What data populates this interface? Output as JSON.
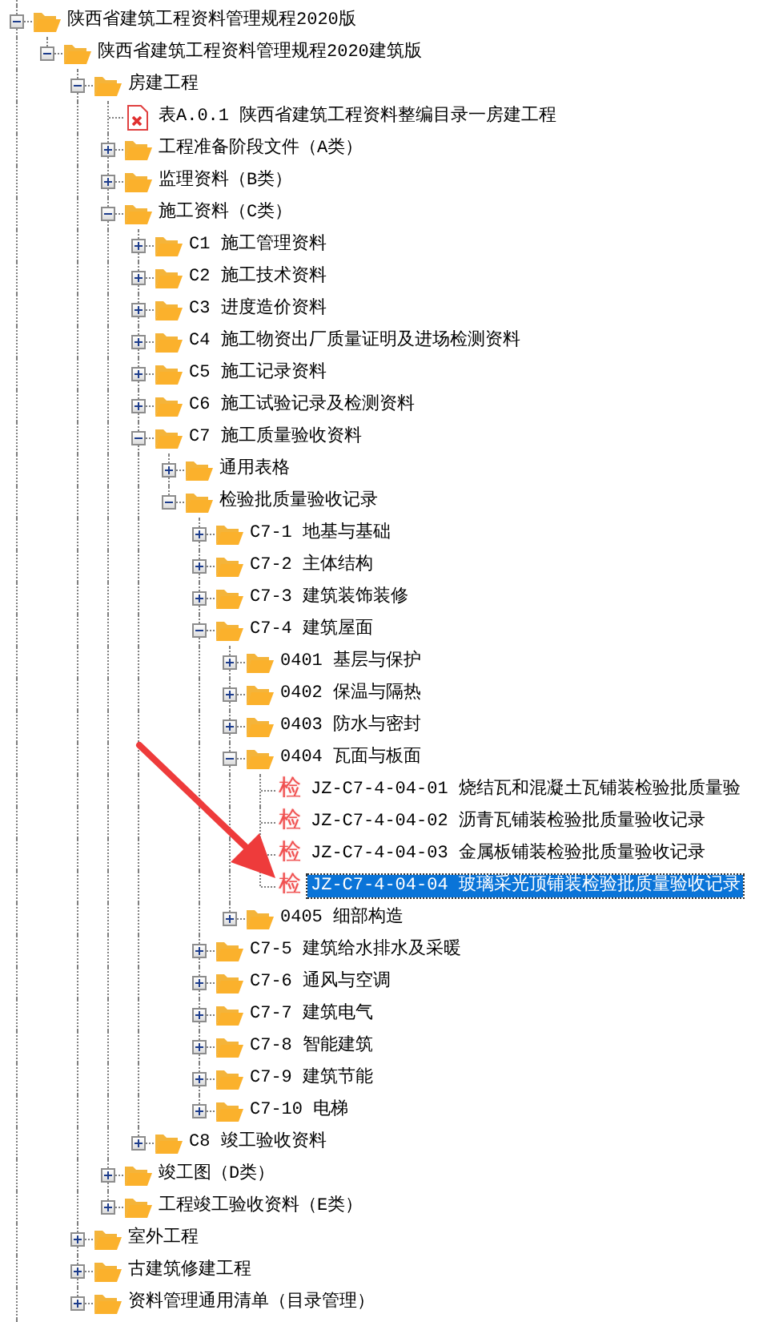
{
  "tree": [
    {
      "kind": "folder",
      "label": "陕西省建筑工程资料管理规程2020版",
      "expanded": true,
      "selected": false,
      "children": [
        {
          "kind": "folder",
          "label": "陕西省建筑工程资料管理规程2020建筑版",
          "expanded": true,
          "selected": false,
          "children": [
            {
              "kind": "folder",
              "label": "房建工程",
              "expanded": true,
              "selected": false,
              "children": [
                {
                  "kind": "file",
                  "label": "表A.0.1 陕西省建筑工程资料整编目录一房建工程",
                  "selected": false
                },
                {
                  "kind": "folder",
                  "label": "工程准备阶段文件（A类）",
                  "expanded": false,
                  "selected": false
                },
                {
                  "kind": "folder",
                  "label": "监理资料（B类）",
                  "expanded": false,
                  "selected": false
                },
                {
                  "kind": "folder",
                  "label": "施工资料（C类）",
                  "expanded": true,
                  "selected": false,
                  "children": [
                    {
                      "kind": "folder",
                      "label": "C1 施工管理资料",
                      "expanded": false,
                      "selected": false
                    },
                    {
                      "kind": "folder",
                      "label": "C2 施工技术资料",
                      "expanded": false,
                      "selected": false
                    },
                    {
                      "kind": "folder",
                      "label": "C3 进度造价资料",
                      "expanded": false,
                      "selected": false
                    },
                    {
                      "kind": "folder",
                      "label": "C4 施工物资出厂质量证明及进场检测资料",
                      "expanded": false,
                      "selected": false
                    },
                    {
                      "kind": "folder",
                      "label": "C5 施工记录资料",
                      "expanded": false,
                      "selected": false
                    },
                    {
                      "kind": "folder",
                      "label": "C6 施工试验记录及检测资料",
                      "expanded": false,
                      "selected": false
                    },
                    {
                      "kind": "folder",
                      "label": "C7 施工质量验收资料",
                      "expanded": true,
                      "selected": false,
                      "children": [
                        {
                          "kind": "folder",
                          "label": "通用表格",
                          "expanded": false,
                          "selected": false
                        },
                        {
                          "kind": "folder",
                          "label": "检验批质量验收记录",
                          "expanded": true,
                          "selected": false,
                          "children": [
                            {
                              "kind": "folder",
                              "label": "C7-1 地基与基础",
                              "expanded": false,
                              "selected": false
                            },
                            {
                              "kind": "folder",
                              "label": "C7-2 主体结构",
                              "expanded": false,
                              "selected": false
                            },
                            {
                              "kind": "folder",
                              "label": "C7-3 建筑装饰装修",
                              "expanded": false,
                              "selected": false
                            },
                            {
                              "kind": "folder",
                              "label": "C7-4 建筑屋面",
                              "expanded": true,
                              "selected": false,
                              "children": [
                                {
                                  "kind": "folder",
                                  "label": "0401 基层与保护",
                                  "expanded": false,
                                  "selected": false
                                },
                                {
                                  "kind": "folder",
                                  "label": "0402 保温与隔热",
                                  "expanded": false,
                                  "selected": false
                                },
                                {
                                  "kind": "folder",
                                  "label": "0403 防水与密封",
                                  "expanded": false,
                                  "selected": false
                                },
                                {
                                  "kind": "folder",
                                  "label": "0404 瓦面与板面",
                                  "expanded": true,
                                  "selected": false,
                                  "children": [
                                    {
                                      "kind": "check",
                                      "badge": "检",
                                      "label": "JZ-C7-4-04-01 烧结瓦和混凝土瓦铺装检验批质量验",
                                      "selected": false
                                    },
                                    {
                                      "kind": "check",
                                      "badge": "检",
                                      "label": "JZ-C7-4-04-02 沥青瓦铺装检验批质量验收记录",
                                      "selected": false
                                    },
                                    {
                                      "kind": "check",
                                      "badge": "检",
                                      "label": "JZ-C7-4-04-03 金属板铺装检验批质量验收记录",
                                      "selected": false
                                    },
                                    {
                                      "kind": "check",
                                      "badge": "检",
                                      "label": "JZ-C7-4-04-04 玻璃采光顶铺装检验批质量验收记录",
                                      "selected": true
                                    }
                                  ]
                                },
                                {
                                  "kind": "folder",
                                  "label": "0405 细部构造",
                                  "expanded": false,
                                  "selected": false
                                }
                              ]
                            },
                            {
                              "kind": "folder",
                              "label": "C7-5 建筑给水排水及采暖",
                              "expanded": false,
                              "selected": false
                            },
                            {
                              "kind": "folder",
                              "label": "C7-6 通风与空调",
                              "expanded": false,
                              "selected": false
                            },
                            {
                              "kind": "folder",
                              "label": "C7-7 建筑电气",
                              "expanded": false,
                              "selected": false
                            },
                            {
                              "kind": "folder",
                              "label": "C7-8 智能建筑",
                              "expanded": false,
                              "selected": false
                            },
                            {
                              "kind": "folder",
                              "label": "C7-9 建筑节能",
                              "expanded": false,
                              "selected": false
                            },
                            {
                              "kind": "folder",
                              "label": "C7-10 电梯",
                              "expanded": false,
                              "selected": false
                            }
                          ]
                        }
                      ]
                    },
                    {
                      "kind": "folder",
                      "label": "C8 竣工验收资料",
                      "expanded": false,
                      "selected": false
                    }
                  ]
                },
                {
                  "kind": "folder",
                  "label": "竣工图（D类）",
                  "expanded": false,
                  "selected": false
                },
                {
                  "kind": "folder",
                  "label": "工程竣工验收资料（E类）",
                  "expanded": false,
                  "selected": false
                }
              ]
            },
            {
              "kind": "folder",
              "label": "室外工程",
              "expanded": false,
              "selected": false
            },
            {
              "kind": "folder",
              "label": "古建筑修建工程",
              "expanded": false,
              "selected": false
            },
            {
              "kind": "folder",
              "label": "资料管理通用清单（目录管理）",
              "expanded": false,
              "selected": false
            }
          ]
        }
      ]
    }
  ]
}
